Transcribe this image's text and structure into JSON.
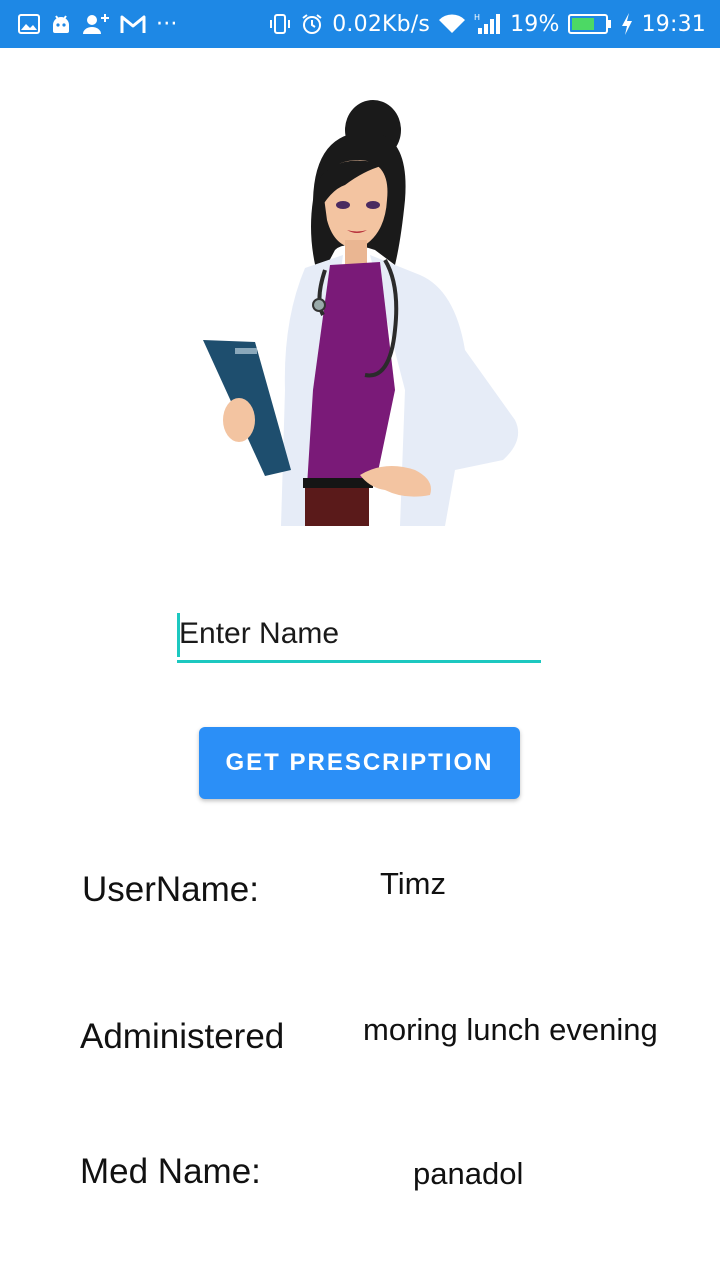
{
  "status_bar": {
    "network_speed": "0.02Kb/s",
    "battery_percent": "19%",
    "time": "19:31",
    "overflow": "···"
  },
  "form": {
    "name_placeholder": "Enter Name",
    "button_label": "GET PRESCRIPTION"
  },
  "info": {
    "username_label": "UserName:",
    "username_value": "Timz",
    "administered_label": "Administered",
    "administered_value": "moring lunch evening",
    "med_name_label": "Med Name:",
    "med_name_value": "panadol"
  },
  "colors": {
    "status_bar": "#1e88e5",
    "accent": "#1cc8c0",
    "button": "#2b8ff7"
  }
}
